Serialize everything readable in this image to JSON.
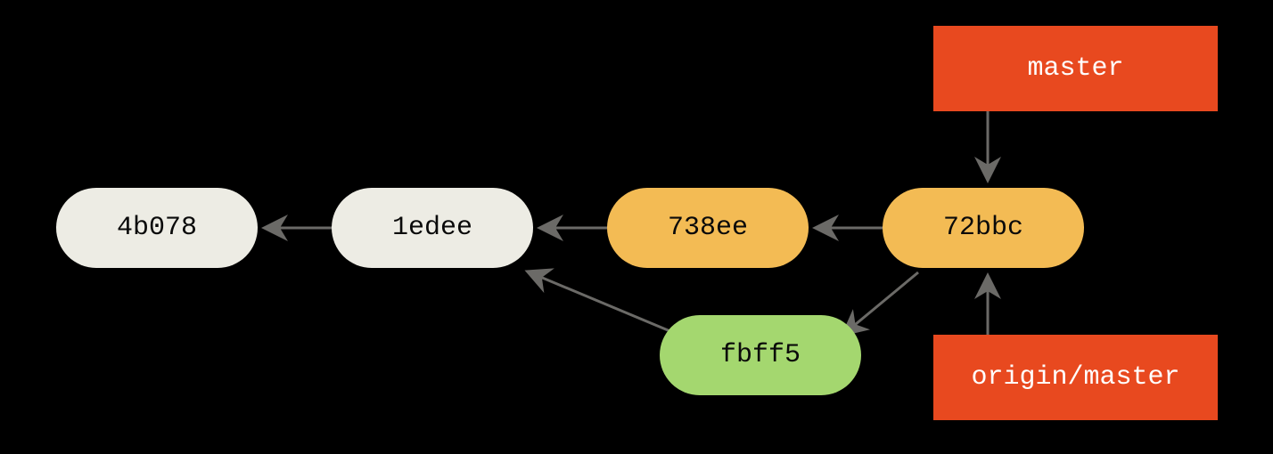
{
  "colors": {
    "commit_old": "#EDECE4",
    "commit_mid": "#F3BB54",
    "commit_new": "#A4D76F",
    "ref": "#E8491F",
    "text_dark": "#0A0A0A",
    "text_light": "#FFFFFF",
    "arrow": "#6B6A67"
  },
  "commits": {
    "c1": {
      "label": "4b078"
    },
    "c2": {
      "label": "1edee"
    },
    "c3": {
      "label": "738ee"
    },
    "c4": {
      "label": "72bbc"
    },
    "c5": {
      "label": "fbff5"
    }
  },
  "refs": {
    "r1": {
      "label": "master"
    },
    "r2": {
      "label": "origin/master"
    }
  },
  "chart_data": {
    "type": "table",
    "title": "Git commit graph with branch refs",
    "nodes": [
      {
        "id": "4b078",
        "kind": "commit",
        "color": "old"
      },
      {
        "id": "1edee",
        "kind": "commit",
        "color": "old"
      },
      {
        "id": "738ee",
        "kind": "commit",
        "color": "mid"
      },
      {
        "id": "72bbc",
        "kind": "commit",
        "color": "mid"
      },
      {
        "id": "fbff5",
        "kind": "commit",
        "color": "new"
      },
      {
        "id": "master",
        "kind": "ref"
      },
      {
        "id": "origin/master",
        "kind": "ref"
      }
    ],
    "edges": [
      {
        "from": "1edee",
        "to": "4b078",
        "type": "parent"
      },
      {
        "from": "738ee",
        "to": "1edee",
        "type": "parent"
      },
      {
        "from": "72bbc",
        "to": "738ee",
        "type": "parent"
      },
      {
        "from": "fbff5",
        "to": "1edee",
        "type": "parent"
      },
      {
        "from": "72bbc",
        "to": "fbff5",
        "type": "parent"
      },
      {
        "from": "master",
        "to": "72bbc",
        "type": "ref-points-to"
      },
      {
        "from": "origin/master",
        "to": "72bbc",
        "type": "ref-points-to"
      }
    ]
  }
}
